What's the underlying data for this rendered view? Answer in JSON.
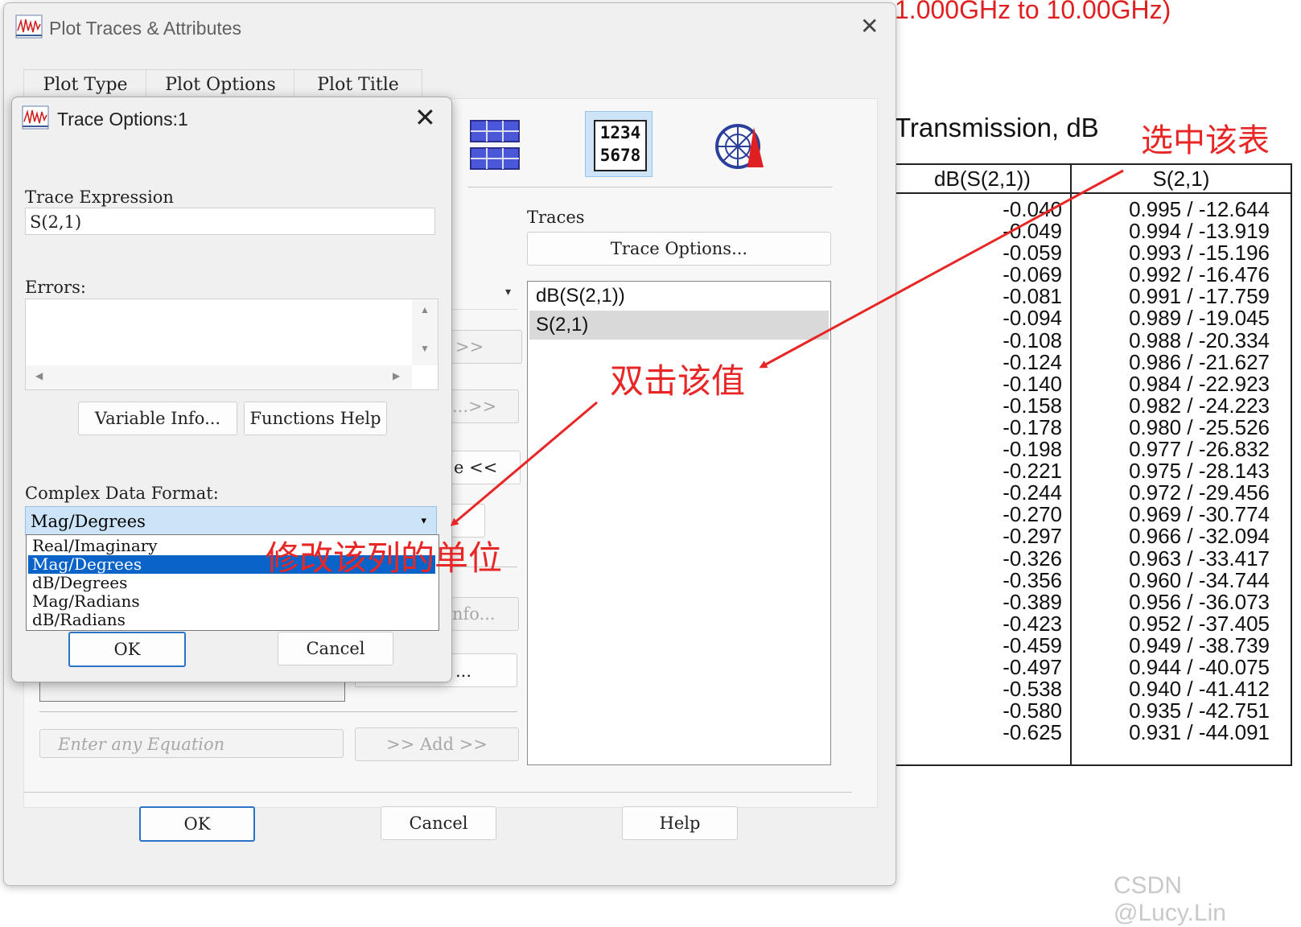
{
  "background": {
    "red_title": "1.000GHz to 10.00GHz)",
    "table_title": "Transmission, dB",
    "annotation_select": "选中该表",
    "table": {
      "headers": [
        "dB(S(2,1))",
        "S(2,1)"
      ],
      "db_values": [
        "-0.040",
        "-0.049",
        "-0.059",
        "-0.069",
        "-0.081",
        "-0.094",
        "-0.108",
        "-0.124",
        "-0.140",
        "-0.158",
        "-0.178",
        "-0.198",
        "-0.221",
        "-0.244",
        "-0.270",
        "-0.297",
        "-0.326",
        "-0.356",
        "-0.389",
        "-0.423",
        "-0.459",
        "-0.497",
        "-0.538",
        "-0.580",
        "-0.625"
      ],
      "s_values": [
        "0.995 / -12.644",
        "0.994 / -13.919",
        "0.993 / -15.196",
        "0.992 / -16.476",
        "0.991 / -17.759",
        "0.989 / -19.045",
        "0.988 / -20.334",
        "0.986 / -21.627",
        "0.984 / -22.923",
        "0.982 / -24.223",
        "0.980 / -25.526",
        "0.977 / -26.832",
        "0.975 / -28.143",
        "0.972 / -29.456",
        "0.969 / -30.774",
        "0.966 / -32.094",
        "0.963 / -33.417",
        "0.960 / -34.744",
        "0.956 / -36.073",
        "0.952 / -37.405",
        "0.949 / -38.739",
        "0.944 / -40.075",
        "0.940 / -41.412",
        "0.935 / -42.751",
        "0.931 / -44.091"
      ]
    },
    "watermark": "CSDN @Lucy.Lin"
  },
  "main_dialog": {
    "title": "Plot Traces & Attributes",
    "close": "✕",
    "tabs": [
      "Plot Type",
      "Plot Options",
      "Plot Title"
    ],
    "plot_type_icons": {
      "table_icon": "1234\n5678"
    },
    "traces_label": "Traces",
    "trace_options_button": "Trace Options...",
    "traces": [
      "dB(S(2,1))",
      "S(2,1)"
    ],
    "partial_buttons": [
      ">>",
      "...>>",
      "e <<",
      "nfo...",
      "..."
    ],
    "equation_placeholder": "Enter any Equation",
    "add_button": ">> Add >>",
    "ok": "OK",
    "cancel": "Cancel",
    "help": "Help"
  },
  "trace_dialog": {
    "title": "Trace Options:1",
    "close": "✕",
    "trace_expression_label": "Trace Expression",
    "trace_expression_value": "S(2,1)",
    "errors_label": "Errors:",
    "variable_info_button": "Variable Info...",
    "functions_help_button": "Functions Help",
    "complex_format_label": "Complex Data Format:",
    "complex_format_selected": "Mag/Degrees",
    "format_options": [
      "Real/Imaginary",
      "Mag/Degrees",
      "dB/Degrees",
      "Mag/Radians",
      "dB/Radians"
    ],
    "ok": "OK",
    "cancel": "Cancel"
  },
  "annotations": {
    "double_click": "双击该值",
    "modify_unit": "修改该列的单位"
  },
  "colors": {
    "annotation_red": "#e82626",
    "selection_blue": "#0a63c9",
    "select_bg": "#cce4f7"
  }
}
